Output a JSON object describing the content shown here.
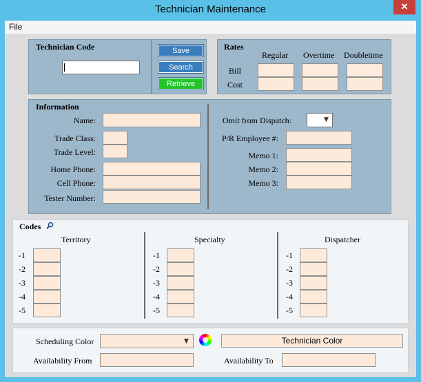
{
  "window": {
    "title": "Technician Maintenance",
    "close_glyph": "✕"
  },
  "menu": {
    "file": "File"
  },
  "tech_code": {
    "heading": "Technician Code",
    "value": ""
  },
  "buttons": {
    "save": "Save",
    "search": "Search",
    "retrieve": "Retrieve"
  },
  "rates": {
    "heading": "Rates",
    "columns": [
      "Regular",
      "Overtime",
      "Doubletime"
    ],
    "rows": [
      "Bill",
      "Cost"
    ]
  },
  "information": {
    "heading": "Information",
    "name": "Name:",
    "trade_class": "Trade Class:",
    "trade_level": "Trade Level:",
    "home_phone": "Home Phone:",
    "cell_phone": "Cell Phone:",
    "tester_number": "Tester Number:",
    "omit_dispatch": "Omit from Dispatch:",
    "pr_employee": "P/R Employee #:",
    "memo1": "Memo 1:",
    "memo2": "Memo 2:",
    "memo3": "Memo 3:"
  },
  "codes": {
    "heading": "Codes",
    "columns": [
      "Territory",
      "Specialty",
      "Dispatcher"
    ],
    "row_labels": [
      "-1",
      "-2",
      "-3",
      "-4",
      "-5"
    ]
  },
  "bottom": {
    "scheduling_color": "Scheduling Color",
    "technician_color": "Technician Color",
    "availability_from": "Availability From",
    "availability_to": "Availability To"
  },
  "icons": {
    "close": "close-icon",
    "search": "search-icon",
    "dropdown": "chevron-down-icon",
    "color_picker": "color-wheel-icon"
  },
  "colors": {
    "titlebar": "#5bc0e8",
    "panel": "#9db7cb",
    "field": "#fdeadb",
    "save_button": "#3a7ebd",
    "retrieve_button": "#22c42a"
  }
}
